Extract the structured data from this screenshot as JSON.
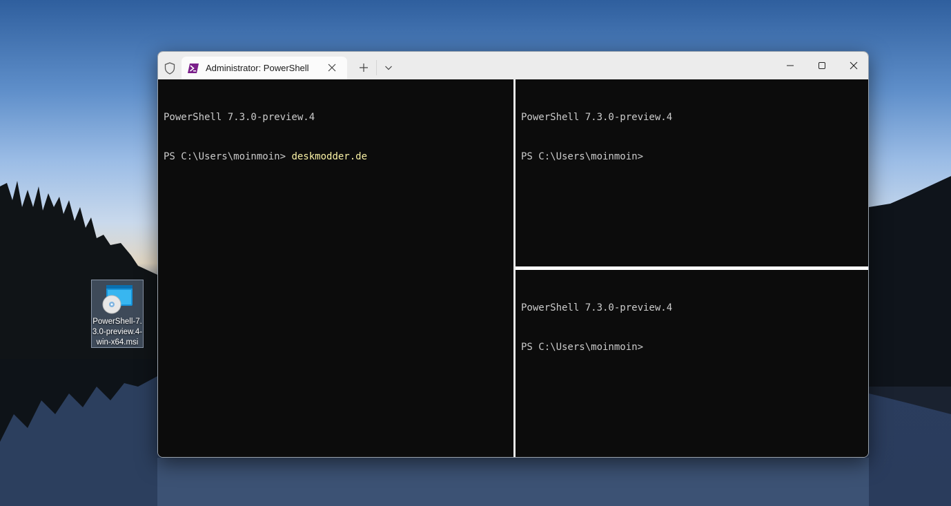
{
  "desktop": {
    "icon": {
      "name": "PowerShell-7.3.0-preview.4-win-x64.msi",
      "icon": "msi-installer-icon"
    }
  },
  "window": {
    "tab": {
      "title": "Administrator: PowerShell",
      "icon": "powershell-icon"
    },
    "icons": {
      "admin_shield": "shield-icon",
      "new_tab": "plus-icon",
      "dropdown": "chevron-down-icon",
      "minimize": "minimize-icon",
      "maximize": "maximize-icon",
      "close": "close-icon"
    },
    "colors": {
      "terminal_bg": "#0c0c0c",
      "terminal_fg": "#cccccc",
      "command_fg": "#f9f1a5",
      "titlebar_bg": "#ececec"
    }
  },
  "panes": {
    "left": {
      "banner": "PowerShell 7.3.0-preview.4",
      "prompt": "PS C:\\Users\\moinmoin> ",
      "command": "deskmodder.de"
    },
    "top_right": {
      "banner": "PowerShell 7.3.0-preview.4",
      "prompt": "PS C:\\Users\\moinmoin>"
    },
    "bottom_right": {
      "banner": "PowerShell 7.3.0-preview.4",
      "prompt": "PS C:\\Users\\moinmoin>"
    }
  }
}
